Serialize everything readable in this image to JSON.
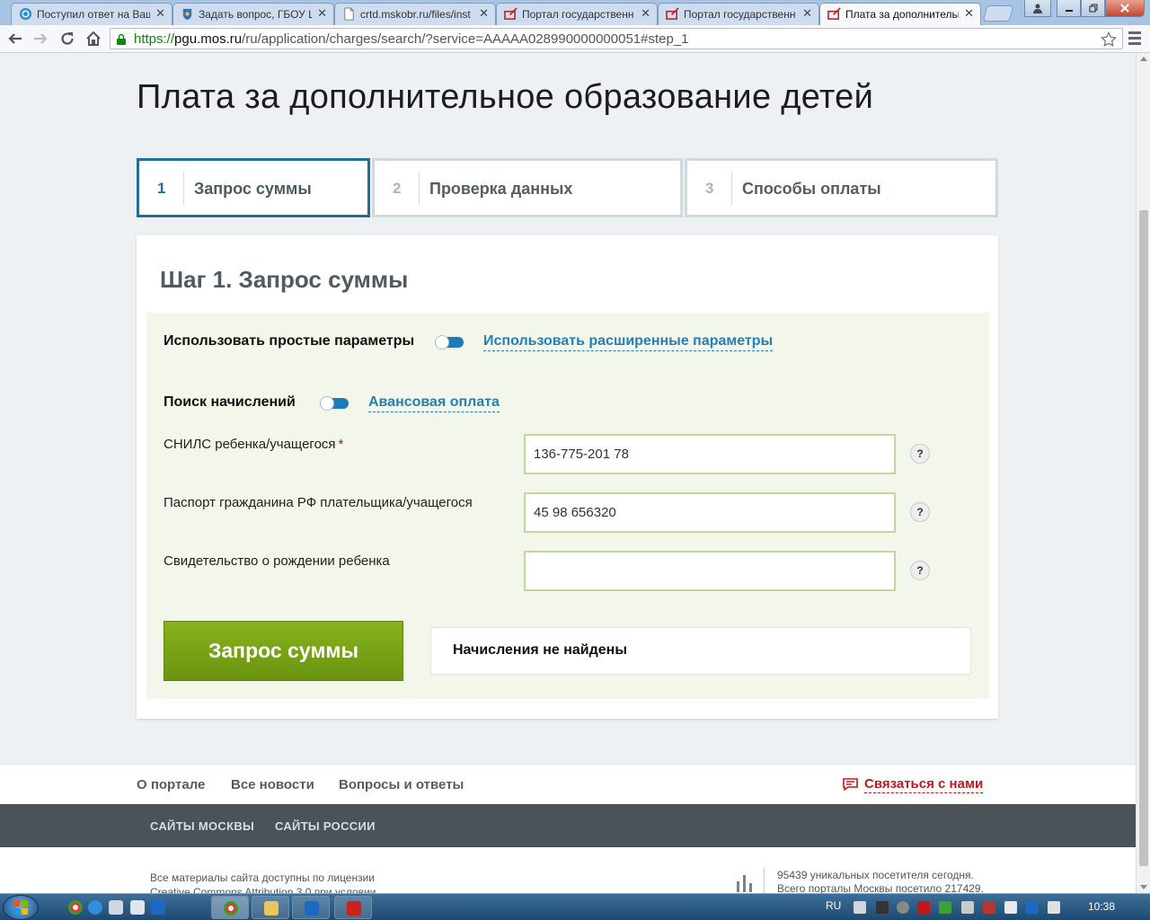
{
  "browser": {
    "tabs": [
      {
        "label": "Поступил ответ на Ваш",
        "active": false
      },
      {
        "label": "Задать вопрос, ГБОУ Ц",
        "active": false
      },
      {
        "label": "crtd.mskobr.ru/files/inst",
        "active": false
      },
      {
        "label": "Портал государственн",
        "active": false
      },
      {
        "label": "Портал государственн",
        "active": false
      },
      {
        "label": "Плата за дополнительн",
        "active": true
      }
    ],
    "tab_close_glyph": "✕",
    "url_protocol": "https://",
    "url_host": "pgu.mos.ru",
    "url_path": "/ru/application/charges/search/?service=AAAAA028990000000051#step_1"
  },
  "page": {
    "title": "Плата за дополнительное образование детей",
    "steps": [
      {
        "number": "1",
        "label": "Запрос суммы",
        "active": true
      },
      {
        "number": "2",
        "label": "Проверка данных",
        "active": false
      },
      {
        "number": "3",
        "label": "Способы оплаты",
        "active": false
      }
    ],
    "card_title": "Шаг 1. Запрос суммы",
    "params_toggle": {
      "left_label": "Использовать простые параметры",
      "right_label": "Использовать расширенные параметры"
    },
    "mode_toggle": {
      "left_label": "Поиск начислений",
      "right_label": "Авансовая оплата"
    },
    "fields": [
      {
        "label": "СНИЛС ребенка/учащегося",
        "required_mark": "*",
        "value": "136-775-201 78"
      },
      {
        "label": "Паспорт гражданина РФ плательщика/учащегося",
        "required_mark": "",
        "value": "45 98 656320"
      },
      {
        "label": "Свидетельство о рождении ребенка",
        "required_mark": "",
        "value": ""
      }
    ],
    "help_glyph": "?",
    "submit_label": "Запрос суммы",
    "result_text": "Начисления не найдены"
  },
  "footer": {
    "links": [
      "О портале",
      "Все новости",
      "Вопросы и ответы"
    ],
    "contact_label": "Связаться с нами",
    "sites": [
      "САЙТЫ МОСКВЫ",
      "САЙТЫ РОССИИ"
    ],
    "license_line1": "Все материалы сайта доступны по лицензии",
    "license_line2": "Creative Commons Attribution 3.0 при условии",
    "stats_line1": "95439 уникальных посетителя сегодня.",
    "stats_line2": "Всего порталы Москвы посетило 217429."
  },
  "taskbar": {
    "lang": "RU",
    "time": "10:38"
  },
  "colors": {
    "accent_blue": "#1f6f97",
    "link_blue": "#2680b8",
    "button_green": "#7aa416",
    "contact_red": "#c0181f",
    "form_bg": "#f3f6ea"
  }
}
